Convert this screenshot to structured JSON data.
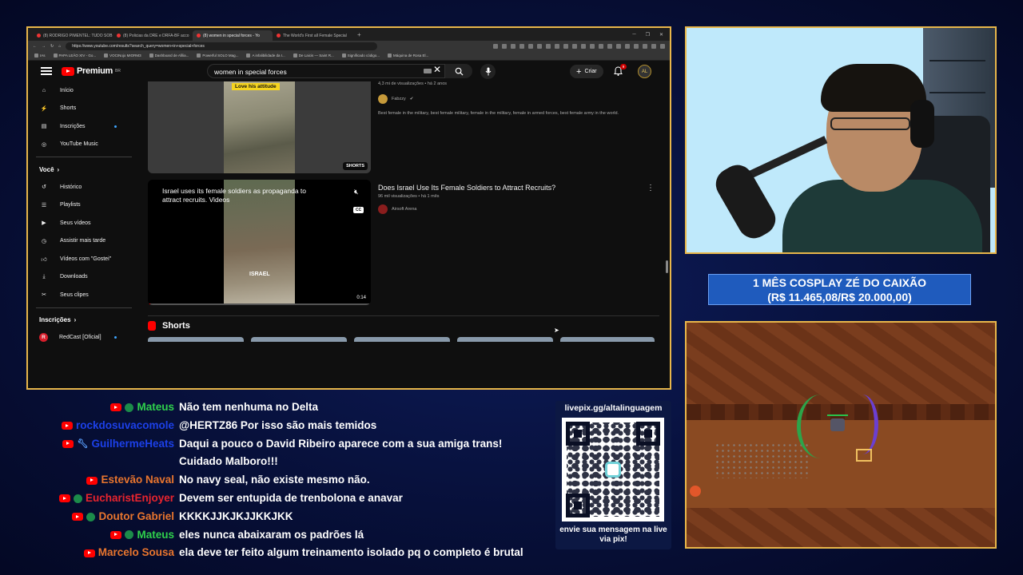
{
  "browser": {
    "tabs": [
      {
        "label": "(8) RODRIGO PIMENTEL: TUDO SOB"
      },
      {
        "label": "(8) Policias da DRE e DRFA-BF acco"
      },
      {
        "label": "(8) women in special forces - Yo",
        "active": true
      },
      {
        "label": "The World's First all Female Special"
      }
    ],
    "new_tab": "+",
    "url": "https://www.youtube.com/results?search_query=women+in+special+forces",
    "bookmarks": [
      "IAs",
      "PAPA LEÃO XIV - Go...",
      "VOCINojo MIORM3",
      "Dashboard de Afilia...",
      "Powerful SOLO Mag...",
      "A infalibilidade da I...",
      "De Laicis — Saint R...",
      "Significado código...",
      "Máquina de Rosa El..."
    ]
  },
  "youtube": {
    "logo": "Premium",
    "logo_region": "BR",
    "search_value": "women in special forces",
    "create_label": "Criar",
    "notif_count": "9",
    "avatar_text": "AL",
    "sidebar": {
      "main": [
        {
          "label": "Início",
          "icon": "home-icon"
        },
        {
          "label": "Shorts",
          "icon": "shorts-icon"
        },
        {
          "label": "Inscrições",
          "icon": "subscriptions-icon"
        },
        {
          "label": "YouTube Music",
          "icon": "music-icon"
        }
      ],
      "you_header": "Você",
      "you": [
        {
          "label": "Histórico",
          "icon": "history-icon"
        },
        {
          "label": "Playlists",
          "icon": "playlists-icon"
        },
        {
          "label": "Seus vídeos",
          "icon": "your-videos-icon"
        },
        {
          "label": "Assistir mais tarde",
          "icon": "watch-later-icon"
        },
        {
          "label": "Vídeos com \"Gostei\"",
          "icon": "like-icon"
        },
        {
          "label": "Downloads",
          "icon": "download-icon"
        },
        {
          "label": "Seus clipes",
          "icon": "clips-icon"
        }
      ],
      "subs_header": "Inscrições",
      "subs": [
        {
          "label": "RedCast [Oficial]",
          "icon": "redcast-icon"
        }
      ]
    },
    "result1": {
      "thumb_caption": "Love his attitude",
      "badge": "SHORTS",
      "meta": "4,3 mi de visualizações • há 2 anos",
      "channel": "Fabzzy",
      "description": "Best female in the military, best female military, female in the military, female in armed forces, best female army in the world."
    },
    "result2": {
      "thumb_caption": "Israel uses its female soldiers as propaganda to attract recruits. Videos",
      "thumb_label": "ISRAEL",
      "duration": "0:14",
      "cc": "CC",
      "title": "Does Israel Use Its Female Soldiers to Attract Recruits?",
      "meta": "96 mil visualizações • há 1 mês",
      "channel": "Airsoft Arena"
    },
    "shorts_header": "Shorts"
  },
  "goal": {
    "line1": "1 MÊS COSPLAY ZÉ DO CAIXÃO",
    "line2": "(R$ 11.465,08/R$ 20.000,00)",
    "progress_fraction": 0.573
  },
  "chat": [
    {
      "name": "Mateus",
      "color": "#2fd14c",
      "badges": [
        "yt",
        "member"
      ],
      "text": "Não tem nenhuma no Delta"
    },
    {
      "name": "rockdosuvacomole",
      "color": "#1c40e8",
      "badges": [
        "yt"
      ],
      "text": "@HERTZ86 Por isso são mais temidos"
    },
    {
      "name": "GuilhermeHeats",
      "color": "#1c40e8",
      "badges": [
        "yt",
        "wrench"
      ],
      "text": "Daqui a pouco o David Ribeiro aparece com a sua amiga trans!"
    },
    {
      "name": "",
      "color": "#ffffff",
      "badges": [],
      "text": "Cuidado Malboro!!!"
    },
    {
      "name": "Estevão Naval",
      "color": "#e8752e",
      "badges": [
        "yt"
      ],
      "text": "No navy seal, não existe mesmo não."
    },
    {
      "name": "EucharistEnjoyer",
      "color": "#e8242e",
      "badges": [
        "yt",
        "member"
      ],
      "text": "Devem ser entupida de trenbolona e anavar"
    },
    {
      "name": "Doutor Gabriel",
      "color": "#e8752e",
      "badges": [
        "yt",
        "member"
      ],
      "text": "KKKKJJKJKJJKKJKK"
    },
    {
      "name": "Mateus",
      "color": "#2fd14c",
      "badges": [
        "yt",
        "member"
      ],
      "text": "eles nunca abaixaram os padrões lá"
    },
    {
      "name": "Marcelo Sousa",
      "color": "#e8752e",
      "badges": [
        "yt"
      ],
      "text": "ela deve ter feito algum treinamento isolado pq o completo é brutal"
    }
  ],
  "pix": {
    "url": "livepix.gg/altalinguagem",
    "cta": "envie sua mensagem na live via pix!"
  }
}
